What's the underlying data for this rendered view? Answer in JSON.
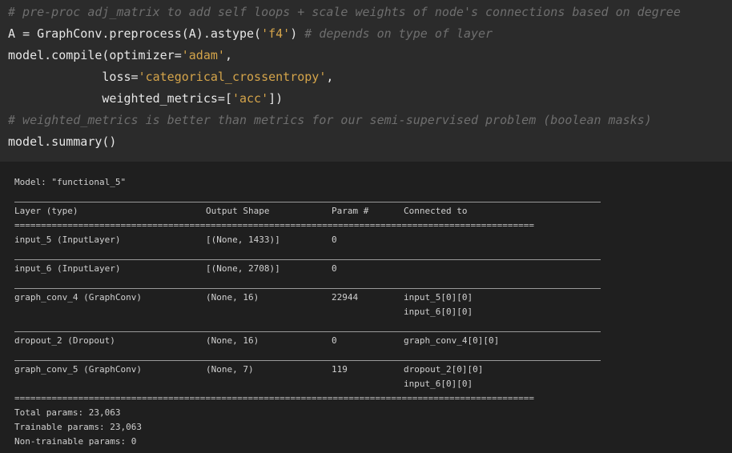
{
  "code": {
    "line1_comment": "# pre-proc adj_matrix to add self loops + scale weights of node's connections based on degree",
    "line2": {
      "prefix": "A ",
      "eq": "=",
      "middle": " GraphConv.preprocess(A).astype(",
      "str": "'f4'",
      "suffix": ") ",
      "comment": "# depends on type of layer"
    },
    "line3": {
      "prefix": "model.compile(optimizer",
      "eq": "=",
      "str": "'adam'",
      "suffix": ","
    },
    "line4": {
      "indent": "             loss",
      "eq": "=",
      "str": "'categorical_crossentropy'",
      "suffix": ","
    },
    "line5": {
      "indent": "             weighted_metrics",
      "eq": "=",
      "open": "[",
      "str": "'acc'",
      "suffix": "])"
    },
    "line6_comment": "# weighted_metrics is better than metrics for our semi-supervised problem (boolean masks)",
    "line7": "model.summary()"
  },
  "summary": {
    "model_line": "Model: \"functional_5\"",
    "headers": [
      "Layer (type)",
      "Output Shape",
      "Param #",
      "Connected to"
    ],
    "separator_eq": "==================================================================================================",
    "rows": [
      {
        "layer": "input_5 (InputLayer)",
        "shape": "[(None, 1433)]",
        "params": "0",
        "connected": [
          "",
          ""
        ]
      },
      {
        "layer": "input_6 (InputLayer)",
        "shape": "[(None, 2708)]",
        "params": "0",
        "connected": [
          "",
          ""
        ]
      },
      {
        "layer": "graph_conv_4 (GraphConv)",
        "shape": "(None, 16)",
        "params": "22944",
        "connected": [
          "input_5[0][0]",
          "input_6[0][0]"
        ]
      },
      {
        "layer": "dropout_2 (Dropout)",
        "shape": "(None, 16)",
        "params": "0",
        "connected": [
          "graph_conv_4[0][0]",
          ""
        ]
      },
      {
        "layer": "graph_conv_5 (GraphConv)",
        "shape": "(None, 7)",
        "params": "119",
        "connected": [
          "dropout_2[0][0]",
          "input_6[0][0]"
        ]
      }
    ],
    "total_params": "Total params: 23,063",
    "trainable_params": "Trainable params: 23,063",
    "non_trainable_params": "Non-trainable params: 0"
  }
}
